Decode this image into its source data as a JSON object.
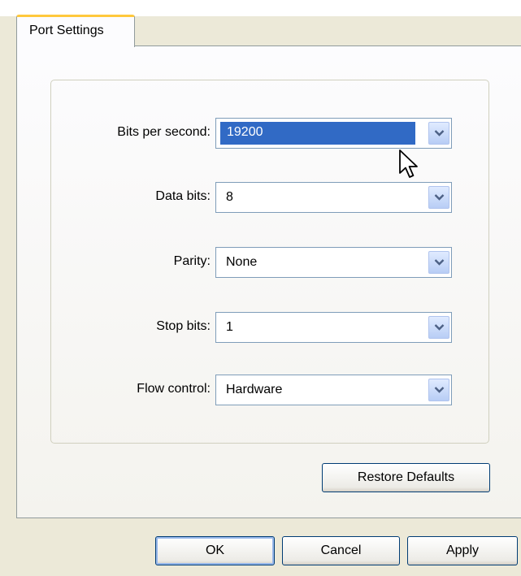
{
  "tab": {
    "label": "Port Settings"
  },
  "settings": [
    {
      "label": "Bits per second:",
      "value": "19200",
      "selected": true
    },
    {
      "label": "Data bits:",
      "value": "8"
    },
    {
      "label": "Parity:",
      "value": "None"
    },
    {
      "label": "Stop bits:",
      "value": "1"
    },
    {
      "label": "Flow control:",
      "value": "Hardware"
    }
  ],
  "buttons": {
    "restore_defaults": "Restore Defaults",
    "ok": "OK",
    "cancel": "Cancel",
    "apply": "Apply"
  },
  "icons": {
    "dropdown": "chevron-down-icon",
    "cursor": "mouse-pointer-icon"
  },
  "colors": {
    "selection": "#316ac5",
    "tab_accent": "#ffc83c"
  }
}
